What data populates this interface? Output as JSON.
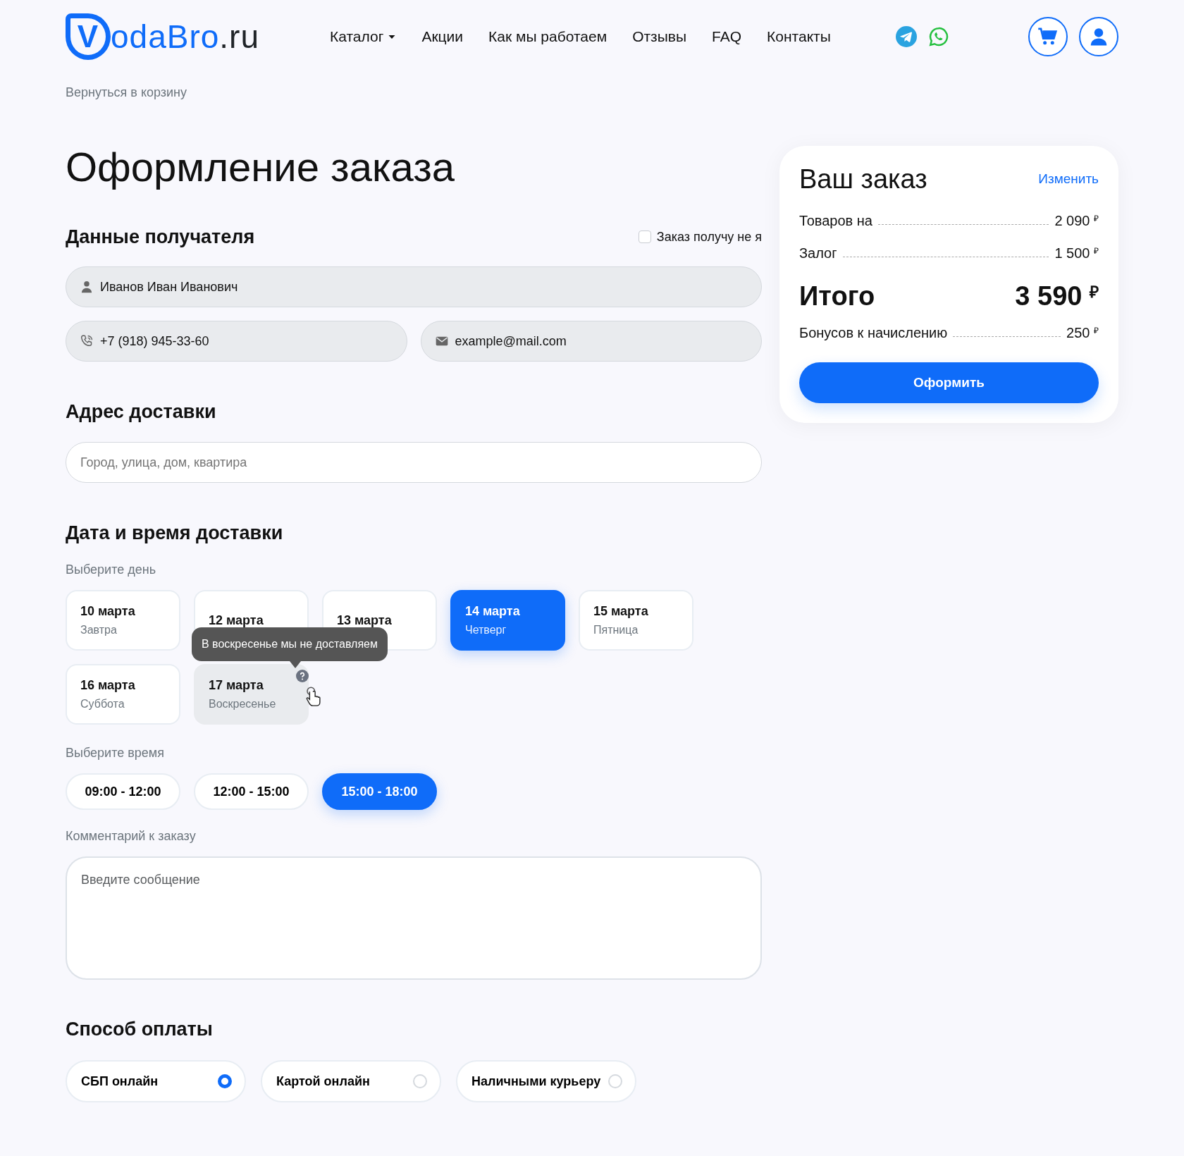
{
  "header": {
    "logo": {
      "mark": "V",
      "name": "odaBro",
      "domain": ".ru"
    },
    "nav": [
      {
        "label": "Каталог",
        "dropdown": true
      },
      {
        "label": "Акции",
        "dropdown": false
      },
      {
        "label": "Как мы работаем",
        "dropdown": false
      },
      {
        "label": "Отзывы",
        "dropdown": false
      },
      {
        "label": "FAQ",
        "dropdown": false
      },
      {
        "label": "Контакты",
        "dropdown": false
      }
    ]
  },
  "back_link": "Вернуться в корзину",
  "title": "Оформление заказа",
  "recipient": {
    "heading": "Данные получателя",
    "other_person": {
      "label": "Заказ получу не я",
      "checked": false
    },
    "name": {
      "value": "Иванов Иван Иванович"
    },
    "phone": {
      "value": "+7 (918) 945-33-60"
    },
    "email": {
      "value": "example@mail.com"
    }
  },
  "address": {
    "heading": "Адрес доставки",
    "placeholder": "Город, улица, дом, квартира"
  },
  "delivery": {
    "heading": "Дата и время доставки",
    "day_label": "Выберите день",
    "days": [
      {
        "date": "10 марта",
        "weekday": "Завтра",
        "selected": false,
        "disabled": false
      },
      {
        "date": "12 марта",
        "selected": false,
        "disabled": false
      },
      {
        "date": "13 марта",
        "selected": false,
        "disabled": false
      },
      {
        "date": "14 марта",
        "weekday": "Четверг",
        "selected": true,
        "disabled": false
      },
      {
        "date": "15 марта",
        "weekday": "Пятница",
        "selected": false,
        "disabled": false
      },
      {
        "date": "16 марта",
        "weekday": "Суббота",
        "selected": false,
        "disabled": false
      },
      {
        "date": "17 марта",
        "weekday": "Воскресенье",
        "selected": false,
        "disabled": true,
        "tooltip": "В воскресенье мы не доставляем"
      }
    ],
    "time_label": "Выберите время",
    "times": [
      {
        "label": "09:00 - 12:00",
        "selected": false
      },
      {
        "label": "12:00 - 15:00",
        "selected": false
      },
      {
        "label": "15:00 - 18:00",
        "selected": true
      }
    ],
    "comment_label": "Комментарий к заказу",
    "comment_placeholder": "Введите сообщение"
  },
  "payment": {
    "heading": "Способ оплаты",
    "options": [
      {
        "label": "СБП онлайн",
        "selected": true
      },
      {
        "label": "Картой онлайн",
        "selected": false
      },
      {
        "label": "Наличными курьеру",
        "selected": false
      }
    ]
  },
  "summary": {
    "title": "Ваш заказ",
    "edit": "Изменить",
    "lines": [
      {
        "label": "Товаров на",
        "value": "2 090 $^{₽}$"
      },
      {
        "label": "Залог",
        "value": "1 500 $^{₽}$"
      }
    ],
    "total": {
      "label": "Итого",
      "value": "3 590 $^{₽}$"
    },
    "bonus": {
      "label": "Бонусов к начислению",
      "value": "250 $^{₽}$"
    },
    "button": "Оформить"
  }
}
